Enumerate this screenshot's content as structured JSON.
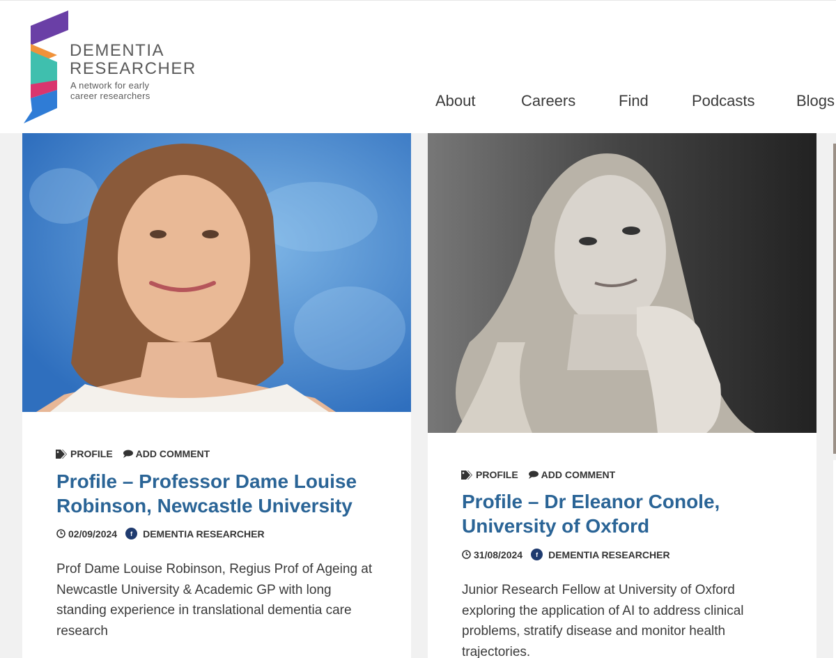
{
  "brand": {
    "name_line1": "DEMENTIA",
    "name_line2": "RESEARCHER",
    "tagline_line1": "A network for early",
    "tagline_line2": "career researchers",
    "colors": {
      "purple": "#6a3fa6",
      "orange": "#f0923a",
      "teal": "#3fbfae",
      "pink": "#d9356e",
      "blue": "#2f7cd6"
    }
  },
  "nav": {
    "items": [
      "About",
      "Careers",
      "Find",
      "Podcasts",
      "Blogs"
    ]
  },
  "posts": [
    {
      "category": "PROFILE",
      "comment_label": "ADD COMMENT",
      "title": "Profile – Professor Dame Louise Robinson, Newcastle University",
      "date": "02/09/2024",
      "author": "DEMENTIA RESEARCHER",
      "excerpt": "Prof Dame Louise Robinson, Regius Prof of Ageing at Newcastle University & Academic GP with long standing experience in translational dementia care research"
    },
    {
      "category": "PROFILE",
      "comment_label": "ADD COMMENT",
      "title": "Profile – Dr Eleanor Conole, University of Oxford",
      "date": "31/08/2024",
      "author": "DEMENTIA RESEARCHER",
      "excerpt": "Junior Research Fellow at University of Oxford exploring the application of AI to address clinical problems, stratify disease and monitor health trajectories."
    }
  ],
  "icons": {
    "tag": "tag-icon",
    "comment": "comment-icon",
    "clock": "clock-icon",
    "author": "author-avatar-icon"
  },
  "colors": {
    "title": "#2a6496",
    "text": "#3a3a3a",
    "background": "#f1f1f1",
    "card": "#ffffff"
  }
}
